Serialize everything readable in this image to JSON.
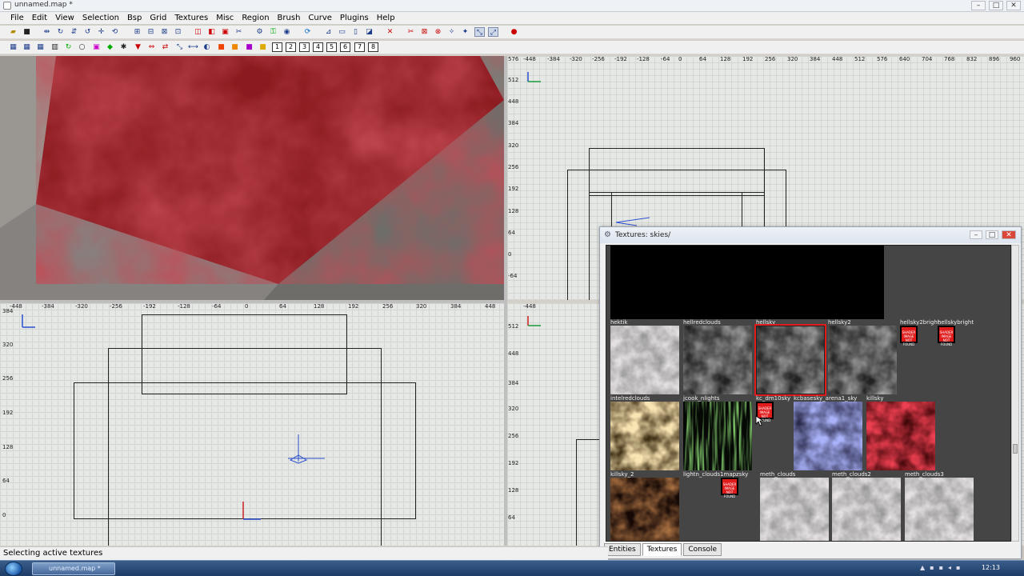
{
  "window": {
    "title": "unnamed.map *"
  },
  "menu": [
    "File",
    "Edit",
    "View",
    "Selection",
    "Bsp",
    "Grid",
    "Textures",
    "Misc",
    "Region",
    "Brush",
    "Curve",
    "Plugins",
    "Help"
  ],
  "toolbar_numbers": [
    "1",
    "2",
    "3",
    "4",
    "5",
    "6",
    "7",
    "8"
  ],
  "views": {
    "top_right": {
      "x_ticks": [
        "-448",
        "-384",
        "-320",
        "-256",
        "-192",
        "-128",
        "-64",
        "0",
        "64",
        "128",
        "192",
        "256",
        "320",
        "384",
        "448",
        "512",
        "576",
        "640",
        "704",
        "768",
        "832",
        "896",
        "960"
      ],
      "y_ticks": [
        "576",
        "512",
        "448",
        "384",
        "320",
        "256",
        "192",
        "128",
        "64",
        "0",
        "-64"
      ]
    },
    "bottom_left": {
      "x_ticks": [
        "-448",
        "-384",
        "-320",
        "-256",
        "-192",
        "-128",
        "-64",
        "0",
        "64",
        "128",
        "192",
        "256",
        "320",
        "384",
        "448"
      ],
      "y_ticks": [
        "384",
        "320",
        "256",
        "192",
        "128",
        "64",
        "0"
      ]
    },
    "bottom_right": {
      "x_ticks": [
        "-448"
      ],
      "y_ticks": [
        "512",
        "448",
        "384",
        "320",
        "256",
        "192",
        "128",
        "64"
      ]
    }
  },
  "status": {
    "text": "Selecting active textures"
  },
  "texture_window": {
    "title": "Textures: skies/",
    "row1_labels": [
      "hektik",
      "hellredclouds",
      "hellsky",
      "hellsky2",
      "hellsky2bright",
      "hellskybright"
    ],
    "row2_labels": [
      "intelredclouds",
      "jcook_nlights",
      "kc_dm10sky",
      "kcbasesky_arena1_sky",
      "killsky"
    ],
    "row3_labels": [
      "killsky_2",
      "lightn_clouds1mapzsky",
      "meth_clouds",
      "meth_clouds2",
      "meth_clouds3"
    ],
    "notfound_text": "SHADER IMAGE NOT FOUND",
    "tabs": [
      "Entities",
      "Textures",
      "Console"
    ]
  },
  "taskbar": {
    "task": "unnamed.map *",
    "clock": "12:13"
  }
}
